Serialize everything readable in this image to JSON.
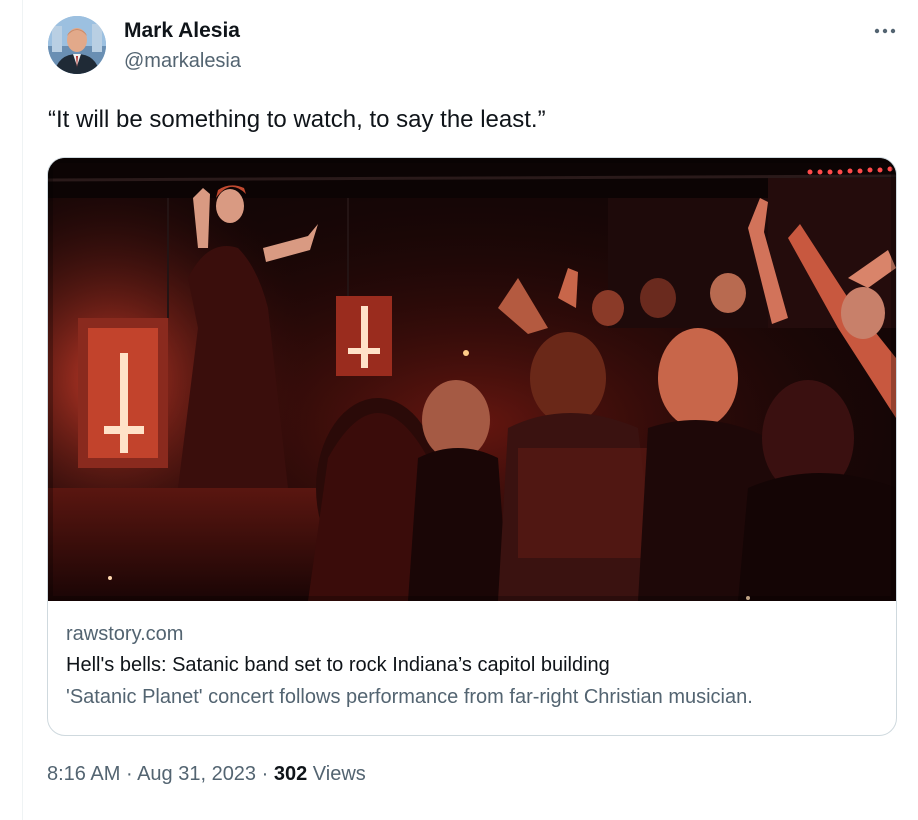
{
  "author": {
    "display_name": "Mark Alesia",
    "handle": "@markalesia",
    "avatar_icon": "profile-photo"
  },
  "more_icon": "more-horizontal-icon",
  "tweet": {
    "text": "“It will be something to watch, to say the least.”"
  },
  "link_card": {
    "image_icon": "concert-photo",
    "domain": "rawstory.com",
    "title": "Hell's bells: Satanic band set to rock Indiana’s capitol building",
    "description": "'Satanic Planet' concert follows performance from far-right Christian musician."
  },
  "meta": {
    "time": "8:16 AM",
    "separator": " · ",
    "date": "Aug 31, 2023",
    "views_count": "302",
    "views_label": " Views"
  },
  "colors": {
    "text_primary": "#0f1419",
    "text_secondary": "#536471",
    "border": "#cfd9de"
  }
}
